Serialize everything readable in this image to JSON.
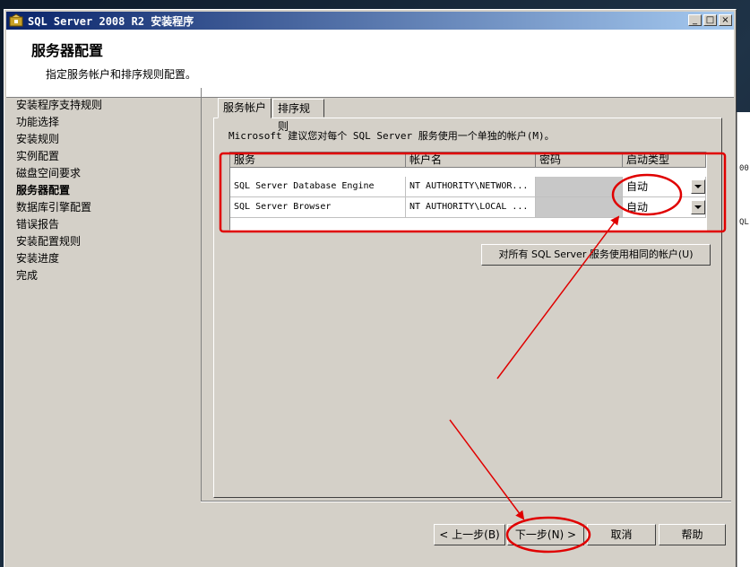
{
  "window": {
    "title": "SQL Server 2008 R2 安装程序",
    "controls": {
      "minimize": "_",
      "maximize": "□",
      "close": "×"
    }
  },
  "header": {
    "title": "服务器配置",
    "subtitle": "指定服务帐户和排序规则配置。"
  },
  "nav": {
    "items": [
      {
        "label": "安装程序支持规则",
        "active": false
      },
      {
        "label": "功能选择",
        "active": false
      },
      {
        "label": "安装规则",
        "active": false
      },
      {
        "label": "实例配置",
        "active": false
      },
      {
        "label": "磁盘空间要求",
        "active": false
      },
      {
        "label": "服务器配置",
        "active": true
      },
      {
        "label": "数据库引擎配置",
        "active": false
      },
      {
        "label": "错误报告",
        "active": false
      },
      {
        "label": "安装配置规则",
        "active": false
      },
      {
        "label": "安装进度",
        "active": false
      },
      {
        "label": "完成",
        "active": false
      }
    ]
  },
  "tabs": [
    {
      "label": "服务帐户",
      "active": true
    },
    {
      "label": "排序规则",
      "active": false
    }
  ],
  "panel": {
    "advice": "Microsoft 建议您对每个 SQL Server 服务使用一个单独的帐户(M)。",
    "columns": [
      "服务",
      "帐户名",
      "密码",
      "启动类型"
    ],
    "rows": [
      {
        "service": "SQL Server Database Engine",
        "account": "NT AUTHORITY\\NETWOR...",
        "password": "",
        "startup": "自动"
      },
      {
        "service": "SQL Server Browser",
        "account": "NT AUTHORITY\\LOCAL ...",
        "password": "",
        "startup": "自动"
      }
    ],
    "same_account_button": "对所有 SQL Server 服务使用相同的帐户(U)"
  },
  "buttons": {
    "back": "< 上一步(B)",
    "next": "下一步(N) >",
    "cancel": "取消",
    "help": "帮助"
  },
  "right_strip": [
    "00",
    "QL"
  ],
  "colors": {
    "titlebar_start": "#0a246a",
    "titlebar_end": "#a6caf0",
    "annotation": "#e00000"
  }
}
